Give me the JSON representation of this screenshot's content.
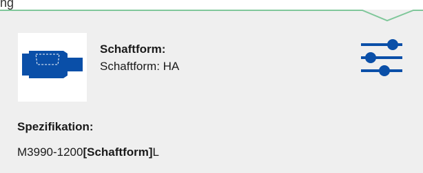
{
  "header": {
    "partial_label": "ng"
  },
  "shaft": {
    "title": "Schaftform:",
    "value": "Schaftform: HA"
  },
  "filter_button": {
    "icon": "sliders-icon"
  },
  "specification": {
    "title": "Spezifikation:",
    "prefix": "M3990-1200",
    "bold": "[Schaftform]",
    "suffix": "L"
  },
  "colors": {
    "panel_bg": "#efefef",
    "accent_green": "#7fc79a",
    "accent_blue": "#0a4fa8"
  }
}
